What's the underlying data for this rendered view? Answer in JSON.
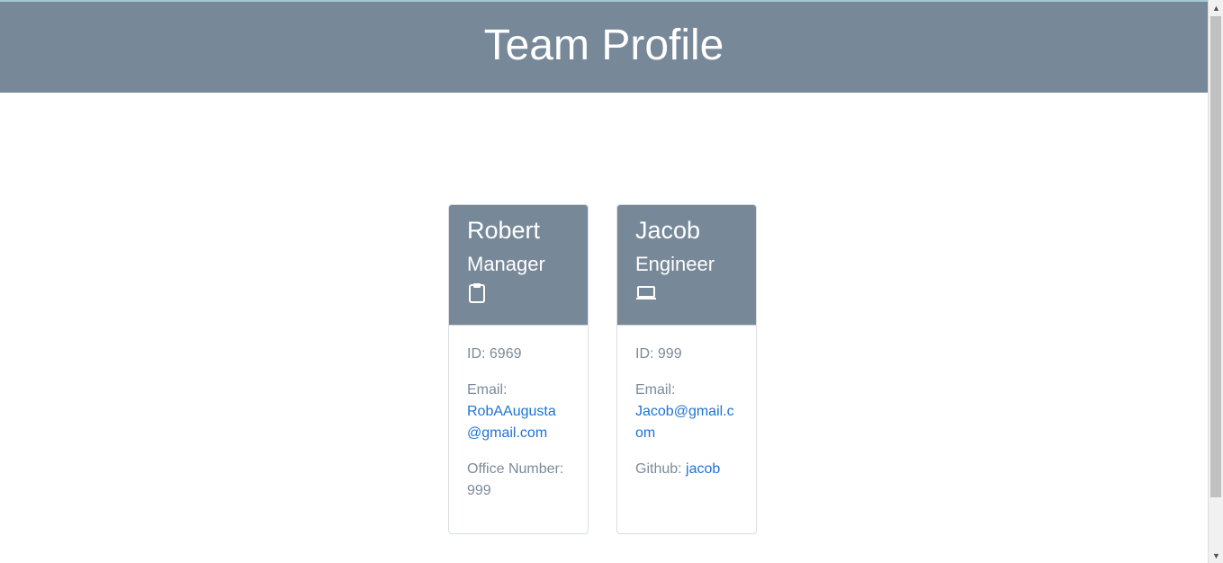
{
  "header": {
    "title": "Team Profile"
  },
  "cards": [
    {
      "name": "Robert",
      "role": "Manager",
      "icon": "clipboard-icon",
      "id_label": "ID:",
      "id_value": "6969",
      "email_label": "Email:",
      "email_value": "RobAAugusta@gmail.com",
      "extra_label": "Office Number:",
      "extra_value": "999"
    },
    {
      "name": "Jacob",
      "role": "Engineer",
      "icon": "laptop-icon",
      "id_label": "ID:",
      "id_value": "999",
      "email_label": "Email:",
      "email_value": "Jacob@gmail.com",
      "extra_label": "Github:",
      "extra_value": "jacob"
    }
  ],
  "colors": {
    "header_bg": "#778899",
    "link": "#1f73d3",
    "muted_text": "#7c8a99"
  }
}
